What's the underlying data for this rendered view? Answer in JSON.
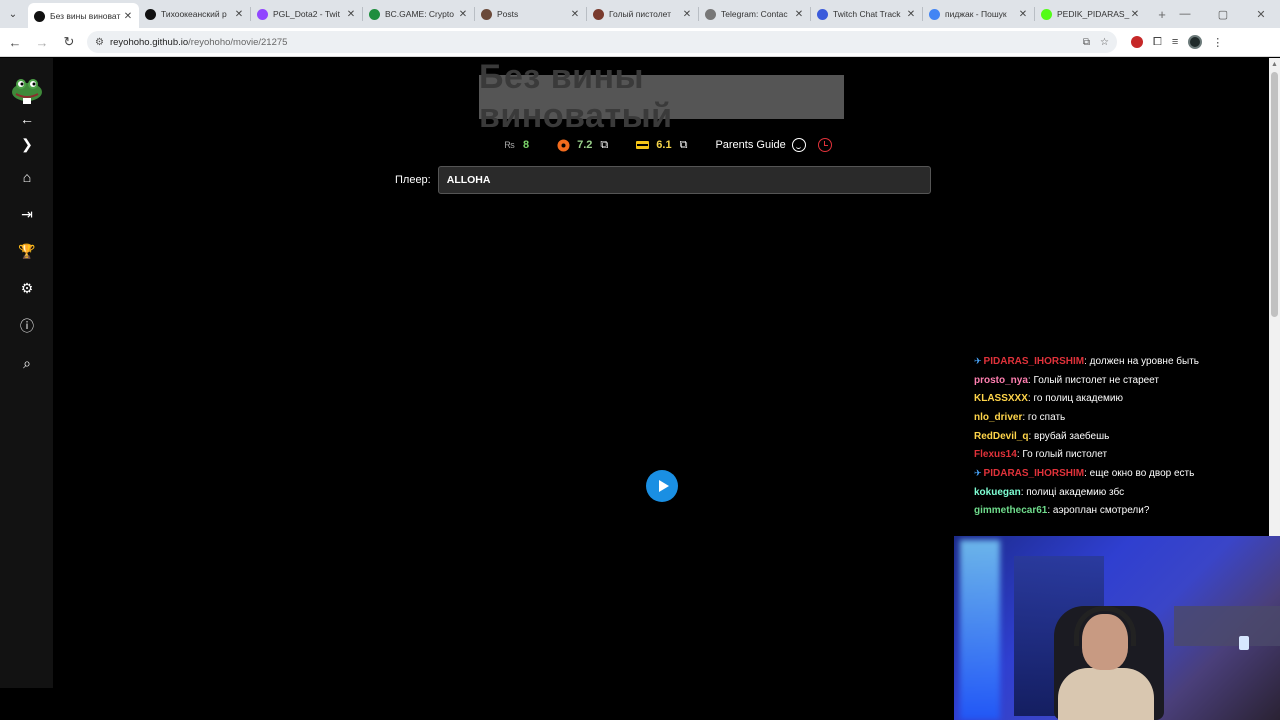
{
  "browser": {
    "tabs": [
      {
        "title": "Без вины виноват",
        "favicon_color": "#111111",
        "active": true
      },
      {
        "title": "Тихоокеанский р",
        "favicon_color": "#111111",
        "active": false
      },
      {
        "title": "PGL_Dota2 - Twit",
        "favicon_color": "#9146ff",
        "active": false
      },
      {
        "title": "BC.GAME: Crypto",
        "favicon_color": "#1e8e3e",
        "active": false
      },
      {
        "title": "Posts",
        "favicon_color": "#6b4a3a",
        "active": false
      },
      {
        "title": "Голый пистолет",
        "favicon_color": "#7a3b2e",
        "active": false
      },
      {
        "title": "Telegram: Contac",
        "favicon_color": "#777777",
        "active": false
      },
      {
        "title": "Twitch Chat Track",
        "favicon_color": "#3b5bdb",
        "active": false
      },
      {
        "title": "пиджак - Пошук",
        "favicon_color": "#4285f4",
        "active": false
      },
      {
        "title": "PEDIK_PIDARAS_I",
        "favicon_color": "#53fc18",
        "active": false
      }
    ],
    "url_host": "reyohoho.github.io",
    "url_path": "/reyohoho/movie/21275"
  },
  "page": {
    "title": "Без вины виноватый",
    "ratings": [
      {
        "source_icon": "rezka-icon",
        "value": "8",
        "color": "#7bd46a",
        "external": false
      },
      {
        "source_icon": "kinopoisk-icon",
        "value": "7.2",
        "color": "#9ad18b",
        "external": true
      },
      {
        "source_icon": "imdb-icon",
        "value": "6.1",
        "color": "#f6d54a",
        "external": true
      }
    ],
    "parents_guide": "Parents Guide",
    "player_label": "Плеер:",
    "player_value": "ALLOHA"
  },
  "chat": [
    {
      "pin": true,
      "user": "PIDARAS_IHORSHIM",
      "user_color": "#e0323a",
      "message": ": должен на уровне быть"
    },
    {
      "pin": false,
      "user": "prosto_nya",
      "user_color": "#ff7fb0",
      "message": ": Голый пистолет не стареет"
    },
    {
      "pin": false,
      "user": "KLASSXXX",
      "user_color": "#ffd54a",
      "message": ": го полиц академию"
    },
    {
      "pin": false,
      "user": "nlo_driver",
      "user_color": "#ffd54a",
      "message": ": го спать"
    },
    {
      "pin": false,
      "user": "RedDevil_q",
      "user_color": "#ffd54a",
      "message": ": врубай заебешь"
    },
    {
      "pin": false,
      "user": "Flexus14",
      "user_color": "#e0323a",
      "message": ": Го голый пистолет"
    },
    {
      "pin": true,
      "user": "PIDARAS_IHORSHIM",
      "user_color": "#e0323a",
      "message": ": еще окно во двор есть"
    },
    {
      "pin": false,
      "user": "kokuegan",
      "user_color": "#7fffd4",
      "message": ": полиці академию збс"
    },
    {
      "pin": false,
      "user": "gimmethecar61",
      "user_color": "#6fdc8c",
      "message": ": аэроплан смотрели?"
    }
  ]
}
